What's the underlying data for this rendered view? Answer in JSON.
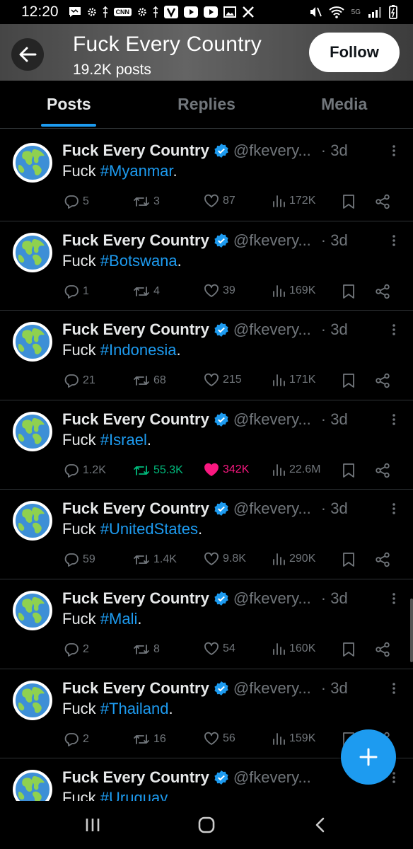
{
  "status_bar": {
    "time": "12:20",
    "network": "5G"
  },
  "header": {
    "title": "Fuck Every Country",
    "subtitle": "19.2K posts",
    "follow_label": "Follow"
  },
  "tabs": [
    {
      "label": "Posts",
      "active": true
    },
    {
      "label": "Replies",
      "active": false
    },
    {
      "label": "Media",
      "active": false
    }
  ],
  "posts": [
    {
      "name": "Fuck Every Country",
      "handle": "@fkevery...",
      "time": "· 3d",
      "prefix": "Fuck ",
      "hashtag": "#Myanmar",
      "suffix": ".",
      "replies": "5",
      "reposts": "3",
      "likes": "87",
      "views": "172K"
    },
    {
      "name": "Fuck Every Country",
      "handle": "@fkevery...",
      "time": "· 3d",
      "prefix": "Fuck ",
      "hashtag": "#Botswana",
      "suffix": ".",
      "replies": "1",
      "reposts": "4",
      "likes": "39",
      "views": "169K"
    },
    {
      "name": "Fuck Every Country",
      "handle": "@fkevery...",
      "time": "· 3d",
      "prefix": "Fuck ",
      "hashtag": "#Indonesia",
      "suffix": ".",
      "replies": "21",
      "reposts": "68",
      "likes": "215",
      "views": "171K"
    },
    {
      "name": "Fuck Every Country",
      "handle": "@fkevery...",
      "time": "· 3d",
      "prefix": "Fuck ",
      "hashtag": "#Israel",
      "suffix": ".",
      "replies": "1.2K",
      "reposts": "55.3K",
      "likes": "342K",
      "views": "22.6M"
    },
    {
      "name": "Fuck Every Country",
      "handle": "@fkevery...",
      "time": "· 3d",
      "prefix": "Fuck ",
      "hashtag": "#UnitedStates",
      "suffix": ".",
      "replies": "59",
      "reposts": "1.4K",
      "likes": "9.8K",
      "views": "290K"
    },
    {
      "name": "Fuck Every Country",
      "handle": "@fkevery...",
      "time": "· 3d",
      "prefix": "Fuck ",
      "hashtag": "#Mali",
      "suffix": ".",
      "replies": "2",
      "reposts": "8",
      "likes": "54",
      "views": "160K"
    },
    {
      "name": "Fuck Every Country",
      "handle": "@fkevery...",
      "time": "· 3d",
      "prefix": "Fuck ",
      "hashtag": "#Thailand",
      "suffix": ".",
      "replies": "2",
      "reposts": "16",
      "likes": "56",
      "views": "159K"
    },
    {
      "name": "Fuck Every Country",
      "handle": "@fkevery...",
      "time": "",
      "prefix": "Fuck ",
      "hashtag": "#Uruguay",
      "suffix": "",
      "replies": "",
      "reposts": "",
      "likes": "",
      "views": ""
    }
  ],
  "colors": {
    "accent": "#1d9bf0",
    "retweet_active": "#00ba7c",
    "like_active": "#f91880",
    "muted": "#71767b"
  },
  "icons": [
    "back-arrow-icon",
    "verified-icon",
    "more-icon",
    "reply-icon",
    "repost-icon",
    "like-icon",
    "views-icon",
    "bookmark-icon",
    "share-icon",
    "compose-plus-icon",
    "recents-icon",
    "home-icon",
    "back-icon"
  ]
}
